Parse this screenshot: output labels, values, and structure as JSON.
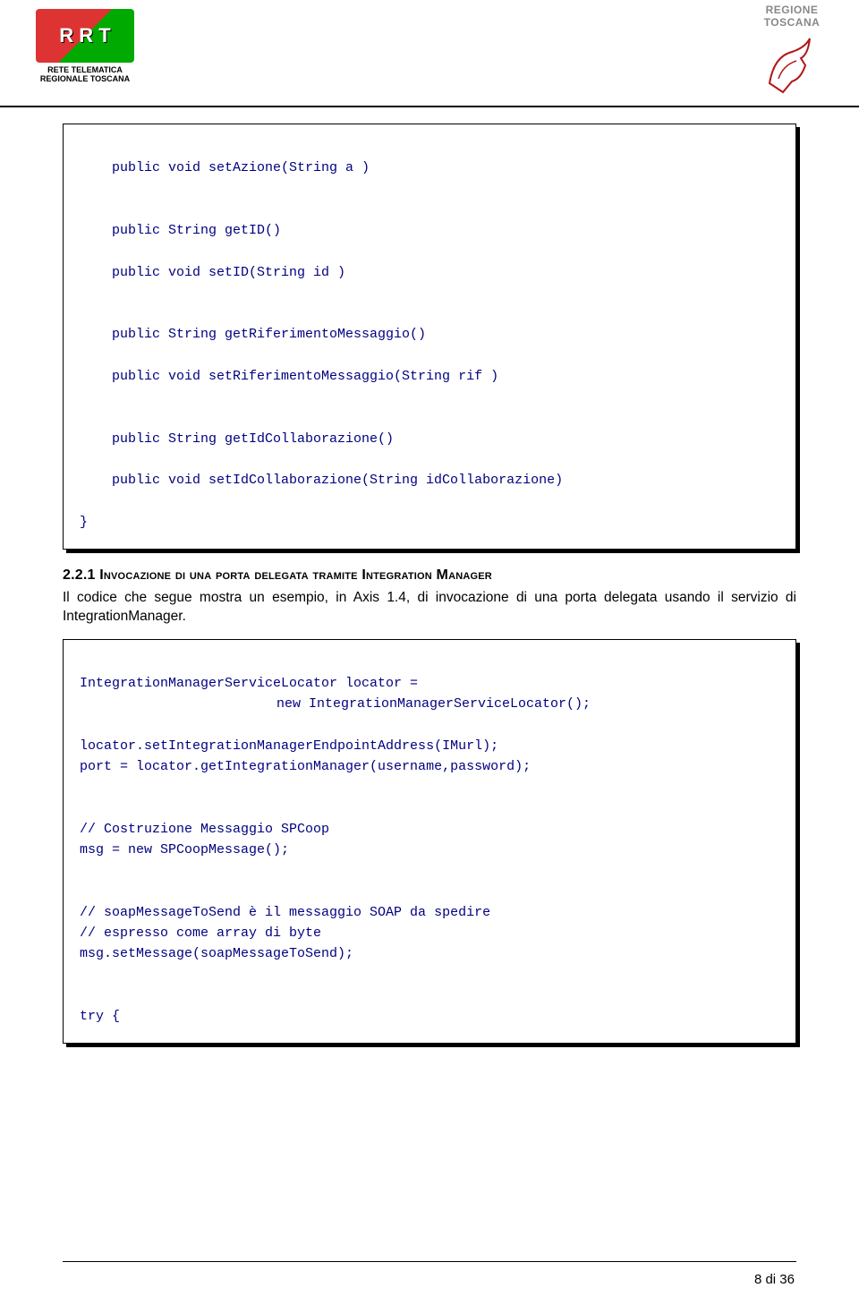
{
  "header": {
    "left_logo_text": "R R T",
    "left_logo_line1": "RETE TELEMATICA",
    "left_logo_line2": "REGIONALE TOSCANA",
    "right_line1": "REGIONE",
    "right_line2": "TOSCANA"
  },
  "codebox1": {
    "l1": "public void setAzione(String a )",
    "l2": "public String getID()",
    "l3": "public void setID(String id )",
    "l4": "public String getRiferimentoMessaggio()",
    "l5": "public void setRiferimentoMessaggio(String rif )",
    "l6": "public String getIdCollaborazione()",
    "l7": "public void setIdCollaborazione(String idCollaborazione)",
    "l8": "}"
  },
  "section": {
    "number": "2.2.1 ",
    "title_sc": "Invocazione di una porta delegata tramite Integration Manager",
    "para": "Il codice che segue mostra un esempio, in Axis 1.4, di invocazione di una porta delegata usando il servizio di IntegrationManager."
  },
  "codebox2": {
    "l1": "IntegrationManagerServiceLocator locator =",
    "l2": "new IntegrationManagerServiceLocator();",
    "l3": "locator.setIntegrationManagerEndpointAddress(IMurl);",
    "l4": "port = locator.getIntegrationManager(username,password);",
    "l5": "// Costruzione Messaggio SPCoop",
    "l6": "msg = new SPCoopMessage();",
    "l7": "// soapMessageToSend è il messaggio SOAP da spedire",
    "l8": "// espresso come array di byte",
    "l9": "msg.setMessage(soapMessageToSend);",
    "l10": "try {"
  },
  "footer": {
    "page": "8 di 36"
  }
}
